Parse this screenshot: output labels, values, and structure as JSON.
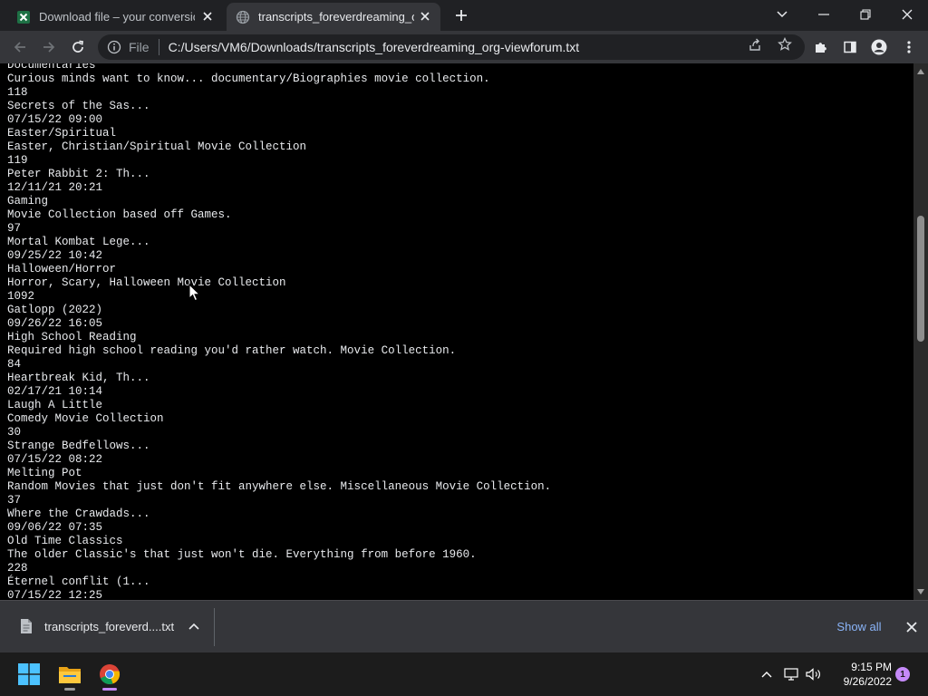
{
  "browser": {
    "tabs": [
      {
        "title": "Download file – your conversion",
        "icon": "excel-icon",
        "active": false
      },
      {
        "title": "transcripts_foreverdreaming_org",
        "icon": "globe-icon",
        "active": true
      }
    ],
    "omnibox": {
      "scheme_label": "File",
      "url": "C:/Users/VM6/Downloads/transcripts_foreverdreaming_org-viewforum.txt"
    }
  },
  "document": {
    "lines": [
      "Documentaries",
      "Curious minds want to know... documentary/Biographies movie collection.",
      "118",
      "Secrets of the Sas...",
      "07/15/22 09:00",
      "Easter/Spiritual",
      "Easter, Christian/Spiritual Movie Collection",
      "119",
      "Peter Rabbit 2: Th...",
      "12/11/21 20:21",
      "Gaming",
      "Movie Collection based off Games.",
      "97",
      "Mortal Kombat Lege...",
      "09/25/22 10:42",
      "Halloween/Horror",
      "Horror, Scary, Halloween Movie Collection",
      "1092",
      "Gatlopp (2022)",
      "09/26/22 16:05",
      "High School Reading",
      "Required high school reading you'd rather watch. Movie Collection.",
      "84",
      "Heartbreak Kid, Th...",
      "02/17/21 10:14",
      "Laugh A Little",
      "Comedy Movie Collection",
      "30",
      "Strange Bedfellows...",
      "07/15/22 08:22",
      "Melting Pot",
      "Random Movies that just don't fit anywhere else. Miscellaneous Movie Collection.",
      "37",
      "Where the Crawdads...",
      "09/06/22 07:35",
      "Old Time Classics",
      "The older Classic's that just won't die. Everything from before 1960.",
      "228",
      "Éternel conflit (1...",
      "07/15/22 12:25"
    ]
  },
  "scrollbar": {
    "position_fraction": 0.36,
    "visible_fraction": 0.25
  },
  "downloads": {
    "file_name": "transcripts_foreverd....txt",
    "show_all_label": "Show all"
  },
  "taskbar": {
    "time": "9:15 PM",
    "date": "9/26/2022",
    "notification_count": "1"
  },
  "colors": {
    "accent_link": "#8ab4f8",
    "chrome_indicator": "#c58af9",
    "excel_green": "#1e7145"
  }
}
